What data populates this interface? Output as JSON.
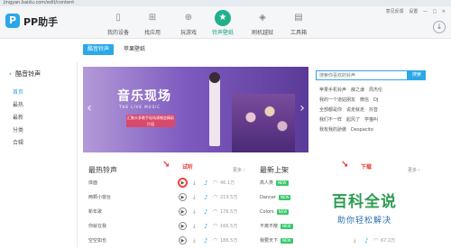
{
  "browser": {
    "url": "jingyan.baidu.com/edit/content"
  },
  "app": {
    "logo_mark": "P",
    "logo_text": "PP助手",
    "nav_tabs": [
      {
        "label": "我的设备",
        "icon": "device-icon"
      },
      {
        "label": "找应用",
        "icon": "apps-icon"
      },
      {
        "label": "玩游戏",
        "icon": "game-icon"
      },
      {
        "label": "铃声壁纸",
        "icon": "ringtone-icon"
      },
      {
        "label": "刷机越狱",
        "icon": "jailbreak-icon"
      },
      {
        "label": "工具箱",
        "icon": "toolbox-icon"
      }
    ],
    "window_controls": {
      "feedback": "意见反馈",
      "settings": "设置",
      "minimize": "—",
      "maximize": "□",
      "close": "×"
    }
  },
  "subtabs": [
    "酷音铃声",
    "苹果壁纸"
  ],
  "sidebar": {
    "heading": "酷音铃声",
    "items": [
      "首页",
      "最热",
      "最新",
      "分类",
      "合辑"
    ]
  },
  "banner": {
    "title": "音乐现场",
    "subtitle": "THE LIVE MUSIC",
    "note": "汇聚众多歌手现场演唱会精彩片段"
  },
  "search": {
    "placeholder": "搜索你喜欢的铃声",
    "button": "搜索"
  },
  "hot_tags": [
    [
      "苹果手机铃声",
      "薛之谦",
      "周杰伦"
    ],
    [
      "我的一个道姑朋友",
      "微信",
      "DJ"
    ],
    [
      "全部都是你",
      "说走就走",
      "抖音"
    ],
    [
      "我们不一样",
      "起风了",
      "学猫叫"
    ],
    [
      "我有我的骄傲",
      "Despacito"
    ]
  ],
  "hot_section": {
    "title": "最热铃声",
    "more": "更多 ›"
  },
  "new_section": {
    "title": "最新上架",
    "more": "更多 ›"
  },
  "annotations": {
    "play": "试听",
    "download": "下载"
  },
  "hot_rows": [
    {
      "title": "体面",
      "size": "46.1万"
    },
    {
      "title": "两颗小窗台",
      "size": "219.5万"
    },
    {
      "title": "新年歌",
      "size": "176.5万"
    },
    {
      "title": "你就在我",
      "size": "166.5万"
    },
    {
      "title": "空空如也",
      "size": "186.5万"
    }
  ],
  "new_rows": [
    {
      "title": "高人类",
      "badge": "NEW"
    },
    {
      "title": "Dancer",
      "badge": "NEW"
    },
    {
      "title": "Colors",
      "badge": "NEW"
    },
    {
      "title": "不离不散",
      "badge": "NEW"
    },
    {
      "title": "我要天下",
      "badge": "NEW",
      "size": "67.2万"
    }
  ],
  "watermark": {
    "main": "百科全说",
    "sub": "助你轻松解决"
  }
}
